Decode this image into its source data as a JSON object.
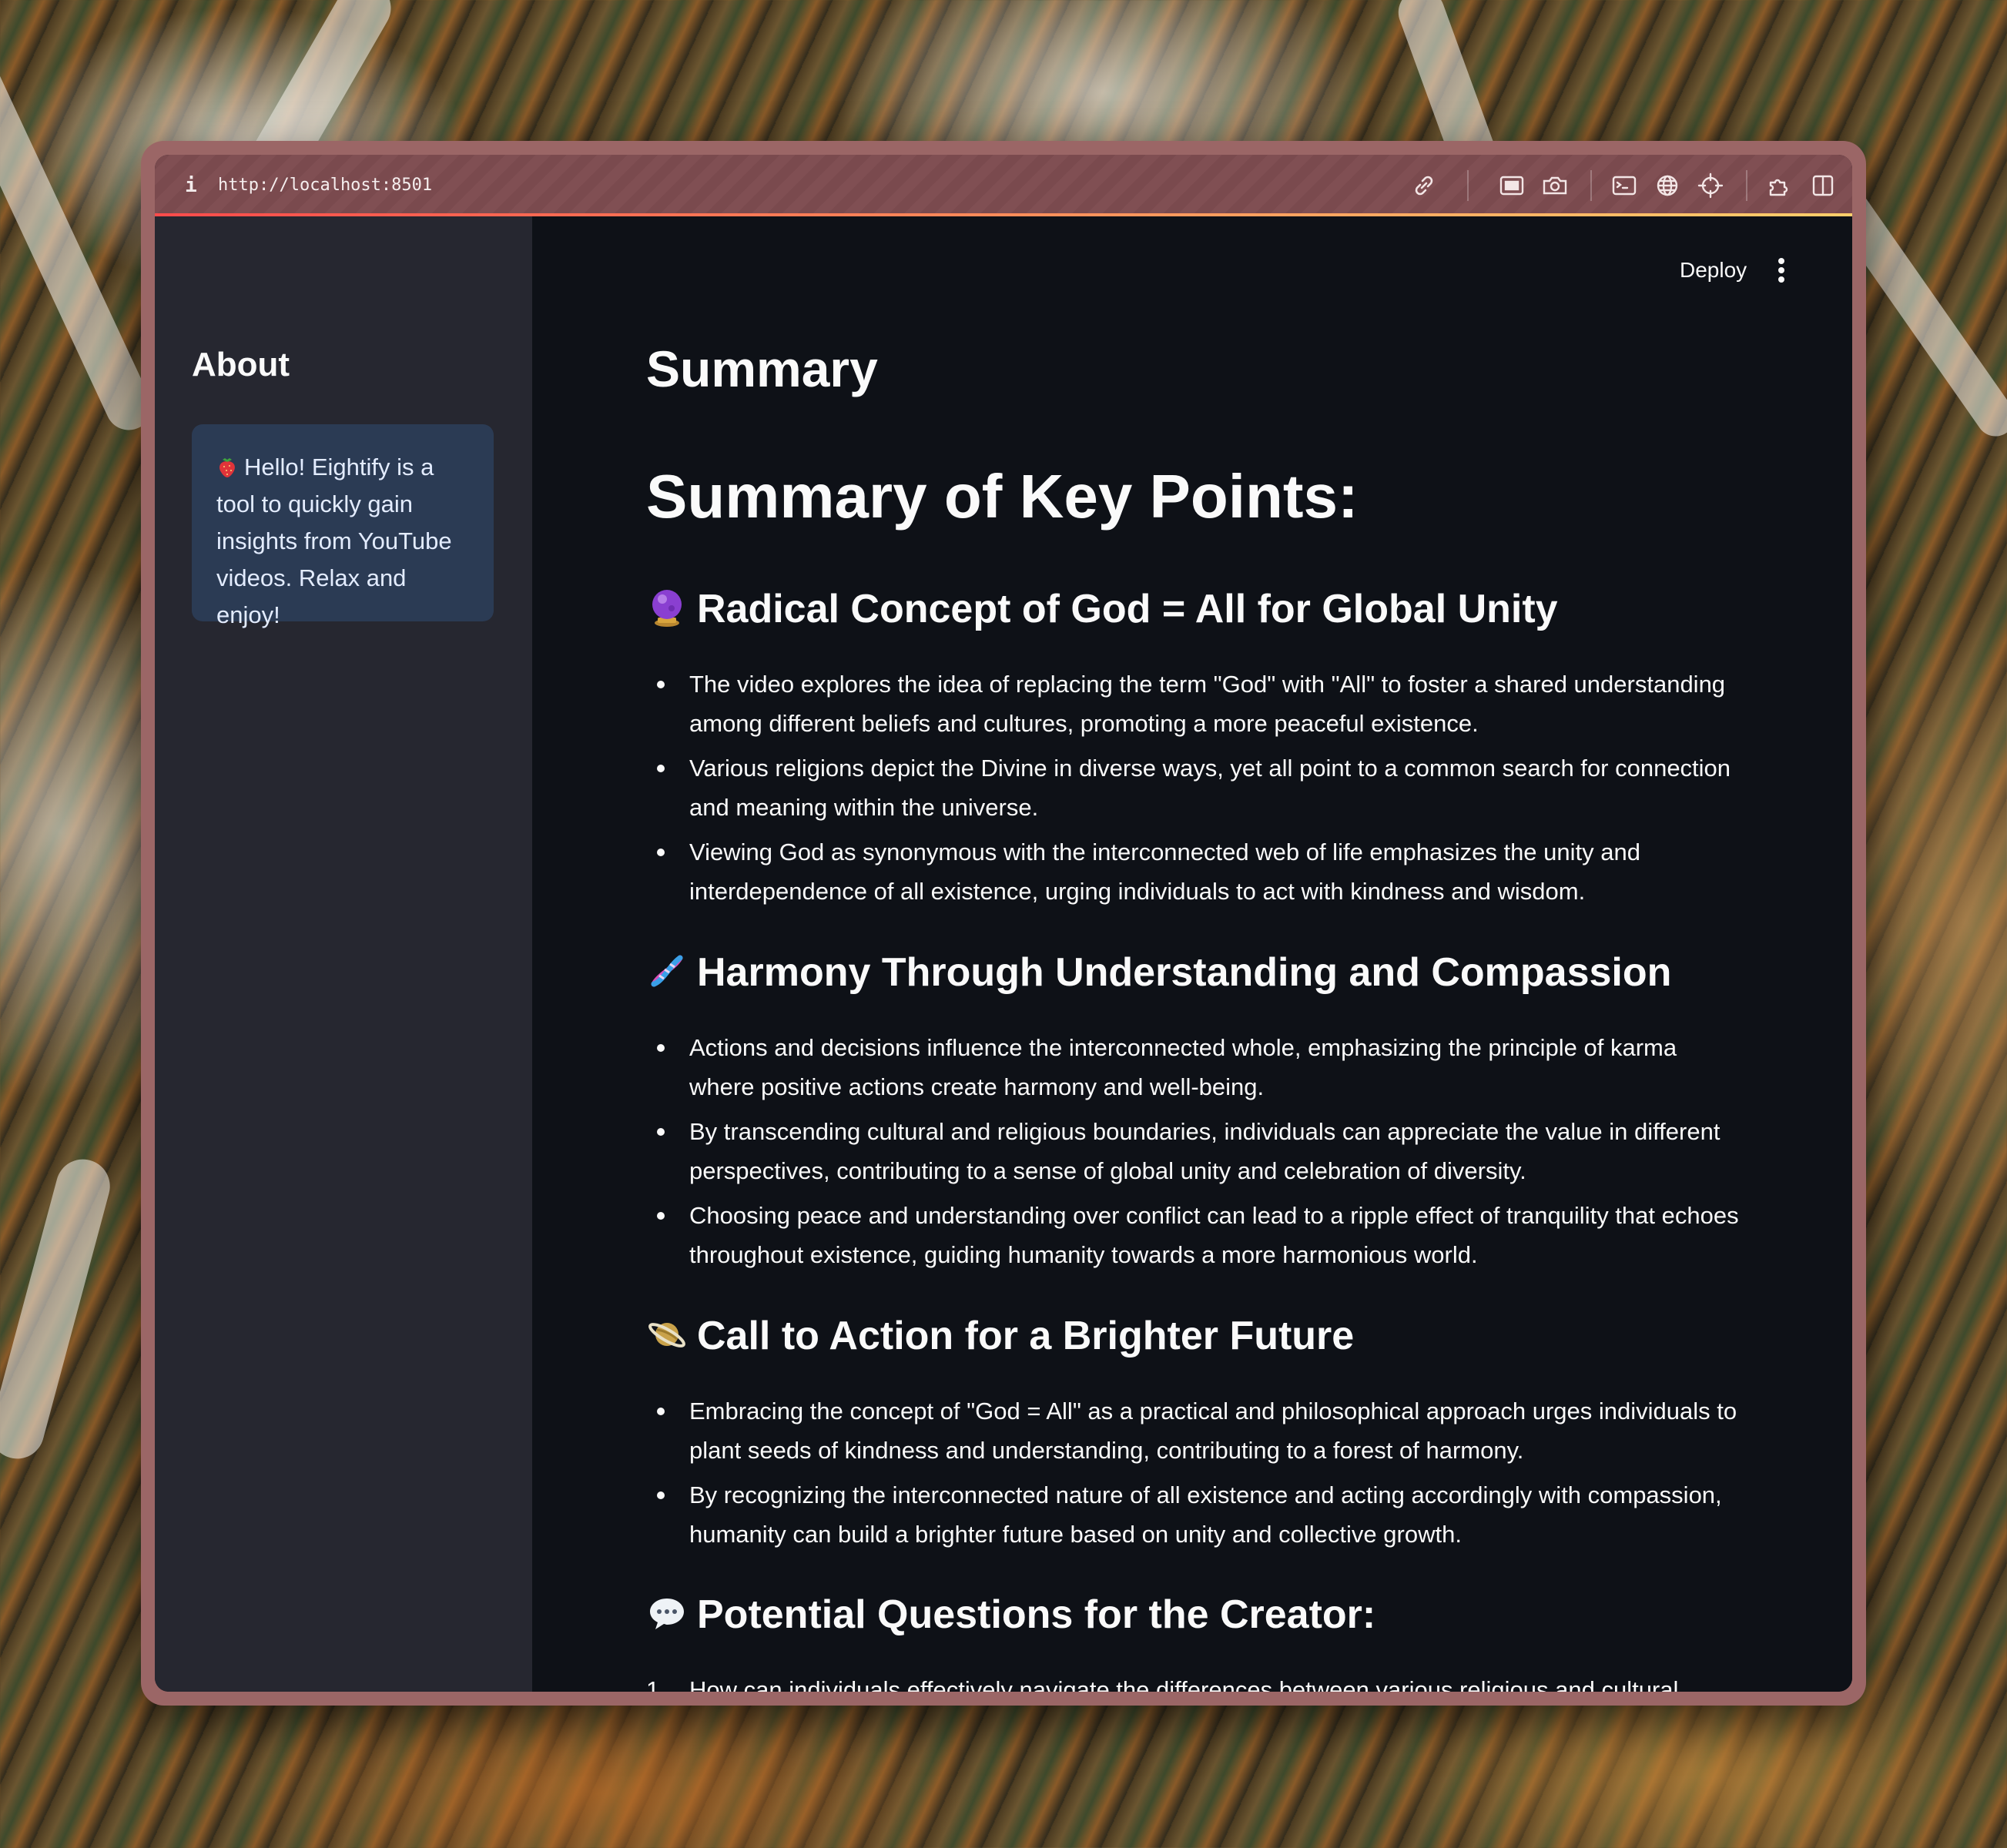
{
  "browser": {
    "url": "http://localhost:8501",
    "info_icon": "i"
  },
  "toolbar_icons": [
    "link-icon",
    "screenshot-window-icon",
    "camera-icon",
    "terminal-icon",
    "globe-icon",
    "crosshair-icon",
    "extensions-icon",
    "sidebar-toggle-icon"
  ],
  "header": {
    "deploy_label": "Deploy"
  },
  "sidebar": {
    "heading": "About",
    "info_text": "Hello! Eightify is a tool to quickly gain insights from YouTube videos. Relax and enjoy!",
    "info_emoji": "strawberry-icon"
  },
  "main": {
    "title": "Summary",
    "h1": "Summary of Key Points:",
    "sections": [
      {
        "emoji": "crystal-ball-icon",
        "title": "Radical Concept of God = All for Global Unity",
        "bullets": [
          "The video explores the idea of replacing the term \"God\" with \"All\" to foster a shared understanding among different beliefs and cultures, promoting a more peaceful existence.",
          "Various religions depict the Divine in diverse ways, yet all point to a common search for connection and meaning within the universe.",
          "Viewing God as synonymous with the interconnected web of life emphasizes the unity and interdependence of all existence, urging individuals to act with kindness and wisdom."
        ]
      },
      {
        "emoji": "dna-icon",
        "title": "Harmony Through Understanding and Compassion",
        "bullets": [
          "Actions and decisions influence the interconnected whole, emphasizing the principle of karma where positive actions create harmony and well-being.",
          "By transcending cultural and religious boundaries, individuals can appreciate the value in different perspectives, contributing to a sense of global unity and celebration of diversity.",
          "Choosing peace and understanding over conflict can lead to a ripple effect of tranquility that echoes throughout existence, guiding humanity towards a more harmonious world."
        ]
      },
      {
        "emoji": "ringed-planet-icon",
        "title": "Call to Action for a Brighter Future",
        "bullets": [
          "Embracing the concept of \"God = All\" as a practical and philosophical approach urges individuals to plant seeds of kindness and understanding, contributing to a forest of harmony.",
          "By recognizing the interconnected nature of all existence and acting accordingly with compassion, humanity can build a brighter future based on unity and collective growth."
        ]
      },
      {
        "emoji": "speech-bubble-icon",
        "title": "Potential Questions for the Creator:",
        "numbered": [
          {
            "num": "1.",
            "text": "How can individuals effectively navigate the differences between various religious and cultural"
          }
        ]
      }
    ]
  },
  "colors": {
    "app_bg": "#0e1117",
    "sidebar_bg": "#262730",
    "info_bg": "#2b3b54",
    "text": "#fafafa",
    "accent_gradient": [
      "#ff4b4b",
      "#ffcf6b"
    ]
  }
}
